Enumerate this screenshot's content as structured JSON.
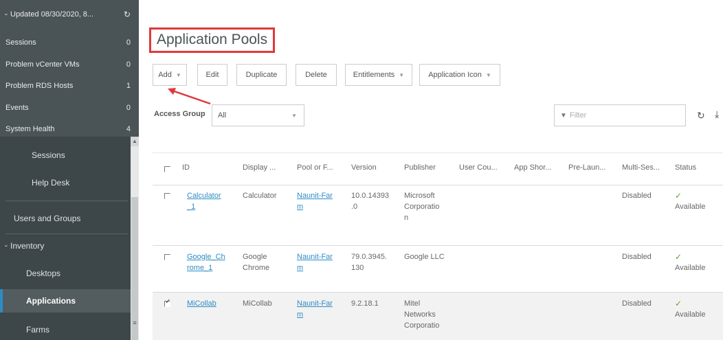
{
  "sidebar": {
    "header": {
      "label": "Updated 08/30/2020, 8...",
      "refresh_icon": "refresh-icon"
    },
    "stats": [
      {
        "label": "Sessions",
        "count": "0"
      },
      {
        "label": "Problem vCenter VMs",
        "count": "0"
      },
      {
        "label": "Problem RDS Hosts",
        "count": "1"
      },
      {
        "label": "Events",
        "count": "0"
      },
      {
        "label": "System Health",
        "count": "4"
      }
    ],
    "nav": {
      "sessions": "Sessions",
      "help_desk": "Help Desk",
      "users_groups": "Users and Groups",
      "inventory": "Inventory",
      "desktops": "Desktops",
      "applications": "Applications",
      "farms": "Farms"
    },
    "scroll_grip": "≡"
  },
  "main": {
    "title": "Application Pools",
    "toolbar": {
      "add": "Add",
      "edit": "Edit",
      "duplicate": "Duplicate",
      "delete": "Delete",
      "entitlements": "Entitlements",
      "application_icon": "Application Icon"
    },
    "access_group": {
      "label": "Access Group",
      "value": "All"
    },
    "filter": {
      "placeholder": "Filter"
    },
    "table": {
      "columns": [
        "ID",
        "Display ...",
        "Pool or F...",
        "Version",
        "Publisher",
        "User Cou...",
        "App Shor...",
        "Pre-Laun...",
        "Multi-Ses...",
        "Status"
      ],
      "rows": [
        {
          "id": [
            "Calculator",
            "_1"
          ],
          "display": [
            "Calculator"
          ],
          "pool": [
            "Naunit-Far",
            "m"
          ],
          "version": [
            "10.0.14393",
            ".0"
          ],
          "publisher": [
            "Microsoft",
            "Corporatio",
            "n"
          ],
          "multi": "Disabled",
          "status": "Available",
          "checked": false
        },
        {
          "id": [
            "Google_Ch",
            "rome_1"
          ],
          "display": [
            "Google",
            "Chrome"
          ],
          "pool": [
            "Naunit-Far",
            "m"
          ],
          "version": [
            "79.0.3945.",
            "130"
          ],
          "publisher": [
            "Google LLC"
          ],
          "multi": "Disabled",
          "status": "Available",
          "checked": false
        },
        {
          "id": [
            "MiCollab"
          ],
          "display": [
            "MiCollab"
          ],
          "pool": [
            "Naunit-Far",
            "m"
          ],
          "version": [
            "9.2.18.1"
          ],
          "publisher": [
            "Mitel",
            "Networks",
            "Corporatio"
          ],
          "multi": "Disabled",
          "status": "Available",
          "checked": true
        }
      ]
    }
  },
  "colors": {
    "highlight": "#e0383a",
    "link": "#2d8cc4",
    "available": "#5aa832",
    "sidebar": "#3d4649"
  }
}
